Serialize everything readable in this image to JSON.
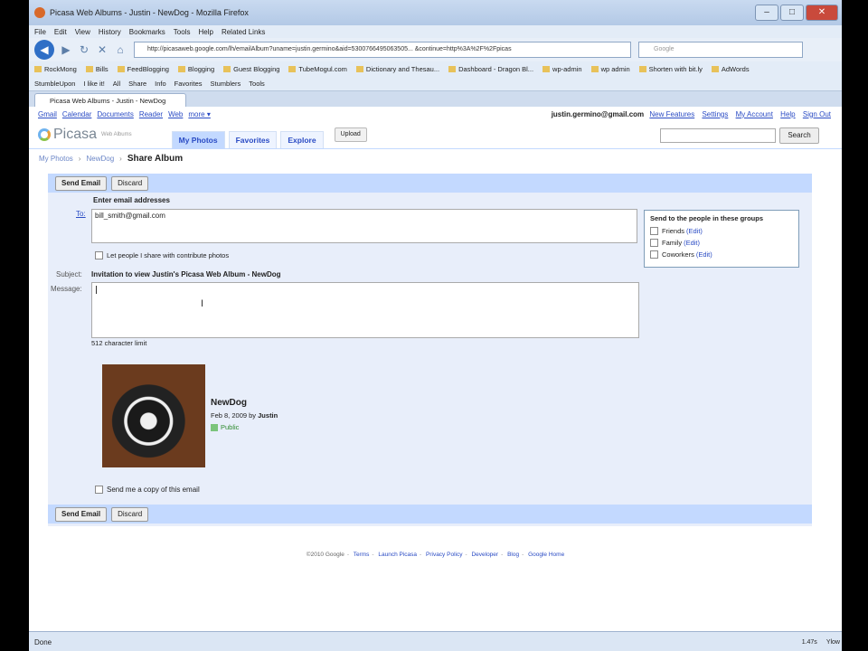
{
  "window": {
    "title": "Picasa Web Albums - Justin - NewDog - Mozilla Firefox"
  },
  "menu": [
    "File",
    "Edit",
    "View",
    "History",
    "Bookmarks",
    "Tools",
    "Help",
    "Related Links"
  ],
  "address": {
    "url": "http://picasaweb.google.com/lh/emailAlbum?uname=justin.germino&aid=5300766495063505... &continue=http%3A%2F%2Fpicas"
  },
  "search_engine": {
    "placeholder": "Google"
  },
  "bookmarks": [
    "RockMong",
    "Bills",
    "FeedBlogging",
    "Blogging",
    "Guest Blogging",
    "TubeMogul.com",
    "Dictionary and Thesau...",
    "Dashboard - Dragon Bl...",
    "wp-admin",
    "wp admin",
    "Shorten with bit.ly",
    "AdWords"
  ],
  "toolbar2": [
    "StumbleUpon",
    "I like it!",
    "All",
    "Share",
    "Info",
    "Favorites",
    "Stumblers",
    "Tools"
  ],
  "tab": {
    "label": "Picasa Web Albums - Justin - NewDog"
  },
  "google_bar": {
    "links": [
      "Gmail",
      "Calendar",
      "Documents",
      "Reader",
      "Web",
      "more ▾"
    ],
    "email": "justin.germino@gmail.com",
    "right_links": [
      "New Features",
      "Settings",
      "My Account",
      "Help",
      "Sign Out"
    ]
  },
  "picasa": {
    "logo": "Picasa",
    "logo_sub": "Web Albums",
    "tabs": [
      "My Photos",
      "Favorites",
      "Explore"
    ],
    "upload": "Upload",
    "search_btn": "Search"
  },
  "breadcrumb": {
    "home": "My Photos",
    "album": "NewDog",
    "current": "Share Album"
  },
  "form": {
    "send_label": "Send Email",
    "discard_label": "Discard",
    "enter_emails": "Enter email addresses",
    "to_label": "To:",
    "to_value": "bill_smith@gmail.com",
    "contribute_label": "Let people I share with contribute photos",
    "subject_label": "Subject:",
    "subject_value": "Invitation to view Justin's Picasa Web Album - NewDog",
    "message_label": "Message:",
    "char_limit": "512 character limit",
    "copy_label": "Send me a copy of this email"
  },
  "groups": {
    "heading": "Send to the people in these groups",
    "items": [
      {
        "name": "Friends",
        "edit": "(Edit)"
      },
      {
        "name": "Family",
        "edit": "(Edit)"
      },
      {
        "name": "Coworkers",
        "edit": "(Edit)"
      }
    ]
  },
  "album": {
    "name": "NewDog",
    "date": "Feb 8, 2009 by",
    "owner": "Justin",
    "visibility": "Public"
  },
  "footer": {
    "copyright": "©2010 Google",
    "links": [
      "Terms",
      "Launch Picasa",
      "Privacy Policy",
      "Developer",
      "Blog",
      "Google Home"
    ]
  },
  "status": {
    "left": "Done",
    "right": [
      "1.47s",
      "Ylow"
    ]
  }
}
